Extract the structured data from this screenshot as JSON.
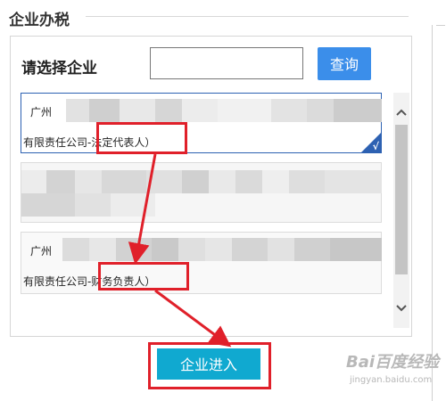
{
  "page": {
    "title": "企业办税"
  },
  "search": {
    "label": "请选择企业",
    "value": "",
    "placeholder": "",
    "button": "查询"
  },
  "companies": [
    {
      "prefix": "广州",
      "suffix": "有限责任公司-",
      "role": "法定代表人）",
      "selected": true
    },
    {
      "prefix": "",
      "suffix": "",
      "role": "",
      "selected": false
    },
    {
      "prefix": "广州",
      "suffix": "有限责任公司-",
      "role": "财务负责人）",
      "selected": false
    }
  ],
  "selected_mark": "√",
  "scrollbar": {
    "up_icon": "chevron-up-icon",
    "down_icon": "chevron-down-icon"
  },
  "enter_button": "企业进入",
  "watermark": {
    "text": "Bai百度经验",
    "sub": "jingyan.baidu.com"
  },
  "colors": {
    "highlight": "#e0202a",
    "query_button": "#3b8eea",
    "enter_button": "#10a9d0",
    "selected_border": "#2d61b2"
  }
}
